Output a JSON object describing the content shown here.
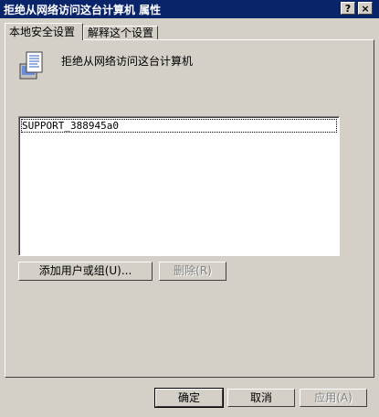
{
  "window": {
    "title": "拒绝从网络访问这台计算机 属性",
    "help_icon": "?",
    "close_icon": "×"
  },
  "tabs": [
    {
      "label": "本地安全设置"
    },
    {
      "label": "解释这个设置"
    }
  ],
  "policy": {
    "icon": "policy-document-icon",
    "name": "拒绝从网络访问这台计算机"
  },
  "accounts": {
    "items": [
      "SUPPORT_388945a0"
    ]
  },
  "buttons": {
    "add": "添加用户或组(U)...",
    "remove": "删除(R)",
    "ok": "确定",
    "cancel": "取消",
    "apply": "应用(A)"
  }
}
